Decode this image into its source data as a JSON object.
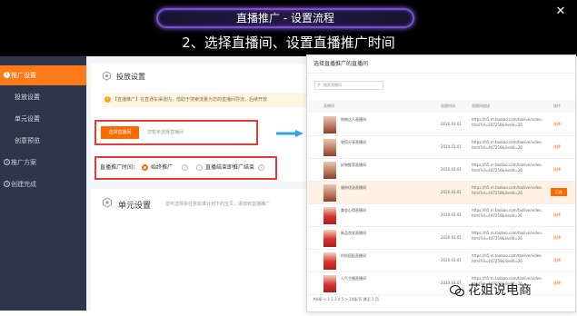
{
  "slide": {
    "title": "直播推广 - 设置流程",
    "subtitle": "2、选择直播间、设置直播推广时间",
    "close_symbol": "✕"
  },
  "sidebar": {
    "section_active": "推广设置",
    "section_active_num": "1",
    "sub_items": [
      "投放设置",
      "单元设置",
      "创意预览"
    ],
    "groups": [
      {
        "num": "2",
        "label": "推广方案"
      },
      {
        "num": "3",
        "label": "创建完成"
      }
    ]
  },
  "main": {
    "delivery_title": "投放设置",
    "tip": "【直播推广】在直通车渠道内，借助于搜索流量为您的直播间导流，后续开放",
    "select_button": "选择直播间",
    "select_hint": "您暂未选择直播间",
    "time_label": "直播推广时间：",
    "option_1": "始终推广",
    "option_2": "直播结束即推广结束",
    "unit_title": "单元设置",
    "unit_hint": "您可选择将任意标准计划下的宝贝，添加到直播推广"
  },
  "modal": {
    "title": "选择直播推广的直播间",
    "search_placeholder": "搜索直播间",
    "columns": [
      "直播间",
      "直播时间",
      "直播间链接",
      "操作"
    ],
    "rows": [
      {
        "name": "购物达人直播间",
        "date": "2020.03.01",
        "link": "https://h5.m.taobao.com/taolive/video.html?id=447259&liveId=26",
        "op": "选择",
        "selected": false,
        "red": false
      },
      {
        "name": "穿搭分享直播间",
        "date": "2020.03.01",
        "link": "https://h5.m.taobao.com/taolive/video.html?id=447259&liveId=26",
        "op": "选择",
        "selected": false,
        "red": false
      },
      {
        "name": "好物推荐直播间",
        "date": "2020.03.01",
        "link": "https://h5.m.taobao.com/taolive/video.html?id=447259&liveId=26",
        "op": "选择",
        "selected": false,
        "red": false
      },
      {
        "name": "服饰优选直播间",
        "date": "2020.03.01",
        "link": "https://h5.m.taobao.com/taolive/video.html?id=447259&liveId=26",
        "op": "已选",
        "selected": true,
        "red": false
      },
      {
        "name": "美妆心得直播间",
        "date": "2020.03.01",
        "link": "https://h5.m.taobao.com/taolive/video.html?id=447259&liveId=26",
        "op": "选择",
        "selected": false,
        "red": true
      },
      {
        "name": "新品首发直播间",
        "date": "2020.03.01",
        "link": "https://h5.m.taobao.com/taolive/video.html?id=447259&liveId=26",
        "op": "选择",
        "selected": false,
        "red": true
      },
      {
        "name": "时尚搭配直播间",
        "date": "2020.03.01",
        "link": "https://h5.m.taobao.com/taolive/video.html?id=447259&liveId=26",
        "op": "选择",
        "selected": false,
        "red": true
      },
      {
        "name": "人气主播直播间",
        "date": "2020.03.01",
        "link": "https://h5.m.taobao.com/taolive/video.html?id=447259&liveId=26",
        "op": "选择",
        "selected": false,
        "red": true
      }
    ],
    "pager": "共8条 < 1 2 3 4 5 > 10条/页 跳至 1 页"
  },
  "watermark": {
    "text": "花姐说电商"
  },
  "colors": {
    "accent": "#ff6a00",
    "highlight_box": "#e03c3c",
    "sidebar": "#2f3649",
    "arrow": "#2aa7e8"
  }
}
